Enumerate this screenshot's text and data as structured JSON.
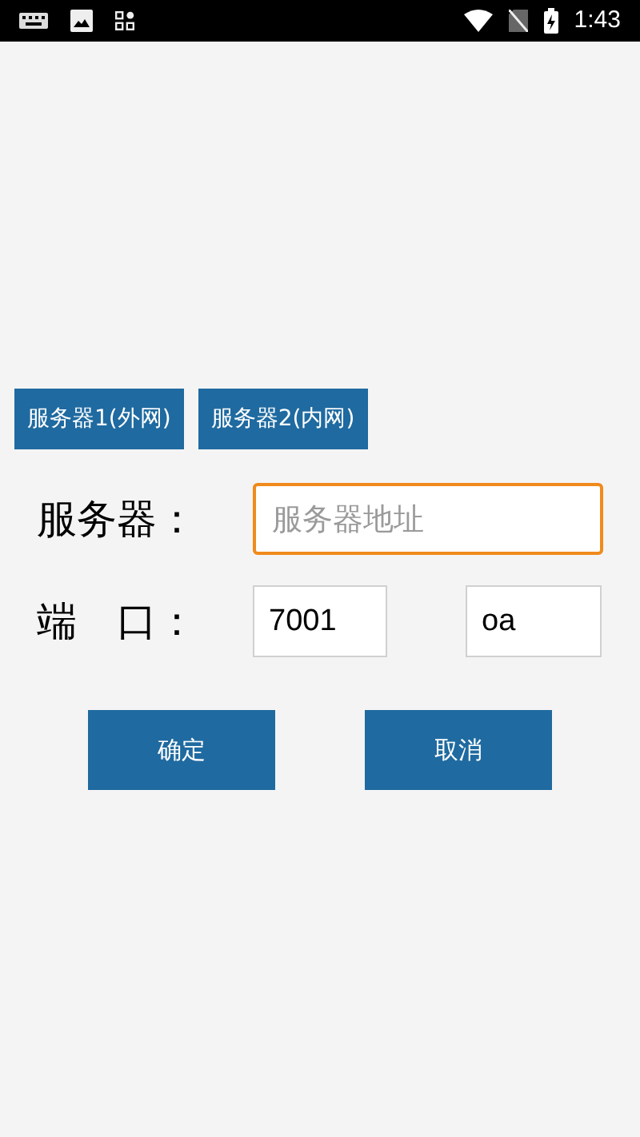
{
  "status_bar": {
    "time": "1:43"
  },
  "presets": [
    {
      "label": "服务器1(外网)"
    },
    {
      "label": "服务器2(内网)"
    }
  ],
  "server": {
    "label": "服务器：",
    "placeholder": "服务器地址",
    "focused": true
  },
  "port": {
    "label": "端　口：",
    "value": "7001",
    "path": "oa"
  },
  "actions": [
    {
      "label": "确定"
    },
    {
      "label": "取消"
    }
  ]
}
